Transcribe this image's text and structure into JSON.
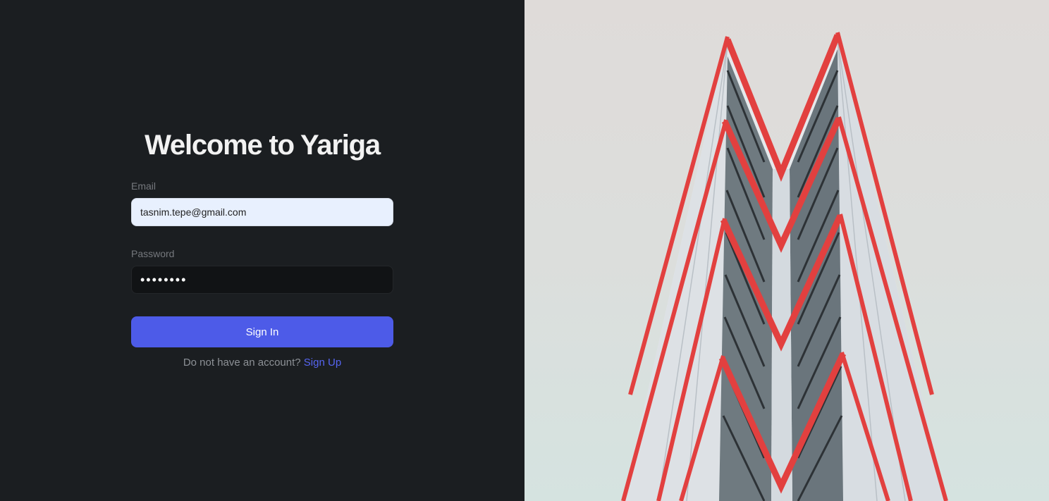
{
  "login": {
    "title": "Welcome to Yariga",
    "email_label": "Email",
    "email_value": "tasnim.tepe@gmail.com",
    "password_label": "Password",
    "password_value": "••••••••",
    "signin_label": "Sign In",
    "no_account_text": "Do not have an account?",
    "signup_label": "Sign Up"
  },
  "colors": {
    "left_bg": "#1b1e21",
    "accent": "#4d5be8",
    "link": "#5665f2",
    "building_stripe": "#e2403f"
  },
  "hero_image": {
    "icon": "building-photo"
  }
}
